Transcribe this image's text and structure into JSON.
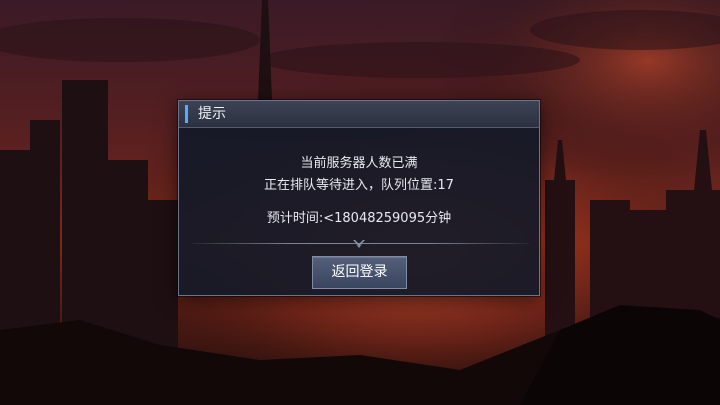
{
  "dialog": {
    "title": "提示",
    "message_line1": "当前服务器人数已满",
    "message_line2": "正在排队等待进入，队列位置:17",
    "estimated_time": "预计时间:<18048259095分钟",
    "button_label": "返回登录"
  },
  "icons": {
    "divider": "chevron-down-icon"
  },
  "colors": {
    "accent": "#5aa8ff",
    "dialog_bg": "#141a28",
    "button": "#465270"
  }
}
